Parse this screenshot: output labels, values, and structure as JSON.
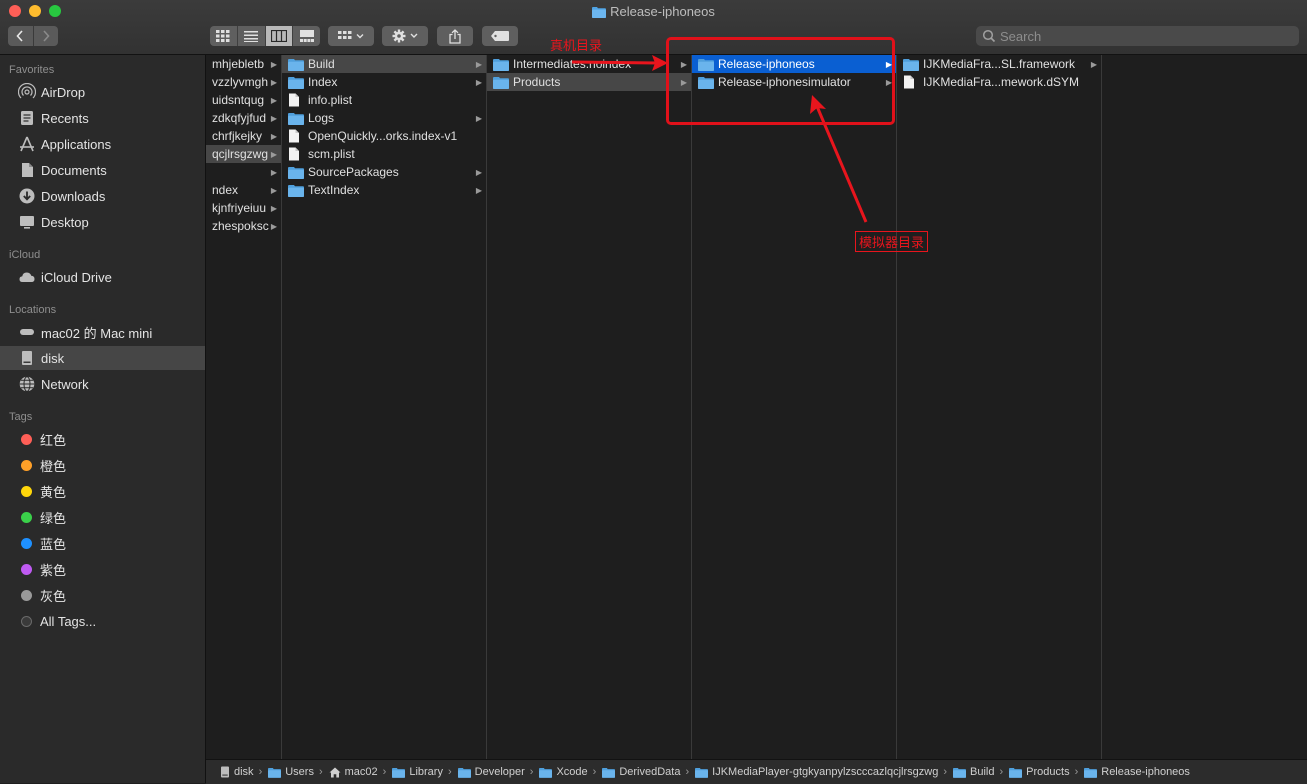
{
  "window": {
    "title": "Release-iphoneos"
  },
  "toolbar": {
    "back_icon": "chevron-left-icon",
    "forward_icon": "chevron-right-icon",
    "view_modes": [
      "icon-view-icon",
      "list-view-icon",
      "column-view-icon",
      "gallery-view-icon"
    ],
    "active_view": "column",
    "search_placeholder": "Search"
  },
  "sidebar": {
    "favorites_title": "Favorites",
    "favorites": [
      {
        "label": "AirDrop",
        "icon": "airdrop-icon"
      },
      {
        "label": "Recents",
        "icon": "recents-icon"
      },
      {
        "label": "Applications",
        "icon": "applications-icon"
      },
      {
        "label": "Documents",
        "icon": "documents-icon"
      },
      {
        "label": "Downloads",
        "icon": "downloads-icon"
      },
      {
        "label": "Desktop",
        "icon": "desktop-icon"
      }
    ],
    "icloud_title": "iCloud",
    "icloud": [
      {
        "label": "iCloud Drive",
        "icon": "cloud-icon"
      }
    ],
    "locations_title": "Locations",
    "locations": [
      {
        "label": "mac02 的 Mac mini",
        "icon": "computer-icon"
      },
      {
        "label": "disk",
        "icon": "disk-icon",
        "selected": true
      },
      {
        "label": "Network",
        "icon": "network-icon"
      }
    ],
    "tags_title": "Tags",
    "tags": [
      {
        "label": "红色",
        "color": "#ff5f57"
      },
      {
        "label": "橙色",
        "color": "#ffa028"
      },
      {
        "label": "黄色",
        "color": "#ffd60a"
      },
      {
        "label": "绿色",
        "color": "#3ad14a"
      },
      {
        "label": "蓝色",
        "color": "#1e90ff"
      },
      {
        "label": "紫色",
        "color": "#bf5af2"
      },
      {
        "label": "灰色",
        "color": "#9a9a9a"
      },
      {
        "label": "All Tags...",
        "color": "#3a3a3a"
      }
    ]
  },
  "columns": {
    "col0": [
      {
        "name": "mhjebletb",
        "folder": true
      },
      {
        "name": "vzzlyvmgh",
        "folder": true
      },
      {
        "name": "uidsntqug",
        "folder": true
      },
      {
        "name": "zdkqfyjfud",
        "folder": true
      },
      {
        "name": "chrfjkejky",
        "folder": true
      },
      {
        "name": "qcjlrsgzwg",
        "folder": true,
        "selected": true
      },
      {
        "name": "",
        "folder": true
      },
      {
        "name": "ndex",
        "folder": true
      },
      {
        "name": "kjnfriyeiuu",
        "folder": true
      },
      {
        "name": "zhespoksc",
        "folder": true
      }
    ],
    "col1": [
      {
        "name": "Build",
        "folder": true,
        "selected": true
      },
      {
        "name": "Index",
        "folder": true
      },
      {
        "name": "info.plist",
        "folder": false
      },
      {
        "name": "Logs",
        "folder": true
      },
      {
        "name": "OpenQuickly...orks.index-v1",
        "folder": false
      },
      {
        "name": "scm.plist",
        "folder": false
      },
      {
        "name": "SourcePackages",
        "folder": true
      },
      {
        "name": "TextIndex",
        "folder": true
      }
    ],
    "col2": [
      {
        "name": "Intermediates.noindex",
        "folder": true
      },
      {
        "name": "Products",
        "folder": true,
        "selected": true
      }
    ],
    "col3": [
      {
        "name": "Release-iphoneos",
        "folder": true,
        "selected_blue": true
      },
      {
        "name": "Release-iphonesimulator",
        "folder": true
      }
    ],
    "col4": [
      {
        "name": "IJKMediaFra...SL.framework",
        "folder": true,
        "arrow": true
      },
      {
        "name": "IJKMediaFra...mework.dSYM",
        "folder": false,
        "arrow": false
      }
    ]
  },
  "pathbar": [
    {
      "label": "disk",
      "icon": "disk-icon"
    },
    {
      "label": "Users",
      "icon": "folder-icon"
    },
    {
      "label": "mac02",
      "icon": "home-icon"
    },
    {
      "label": "Library",
      "icon": "folder-icon"
    },
    {
      "label": "Developer",
      "icon": "folder-icon"
    },
    {
      "label": "Xcode",
      "icon": "folder-icon"
    },
    {
      "label": "DerivedData",
      "icon": "folder-icon"
    },
    {
      "label": "IJKMediaPlayer-gtgkyanpylzscccazlqcjlrsgzwg",
      "icon": "folder-icon"
    },
    {
      "label": "Build",
      "icon": "folder-icon"
    },
    {
      "label": "Products",
      "icon": "folder-icon"
    },
    {
      "label": "Release-iphoneos",
      "icon": "folder-icon"
    }
  ],
  "annotations": {
    "device_label": "真机目录",
    "simulator_label": "模拟器目录",
    "color": "#e8151d"
  }
}
